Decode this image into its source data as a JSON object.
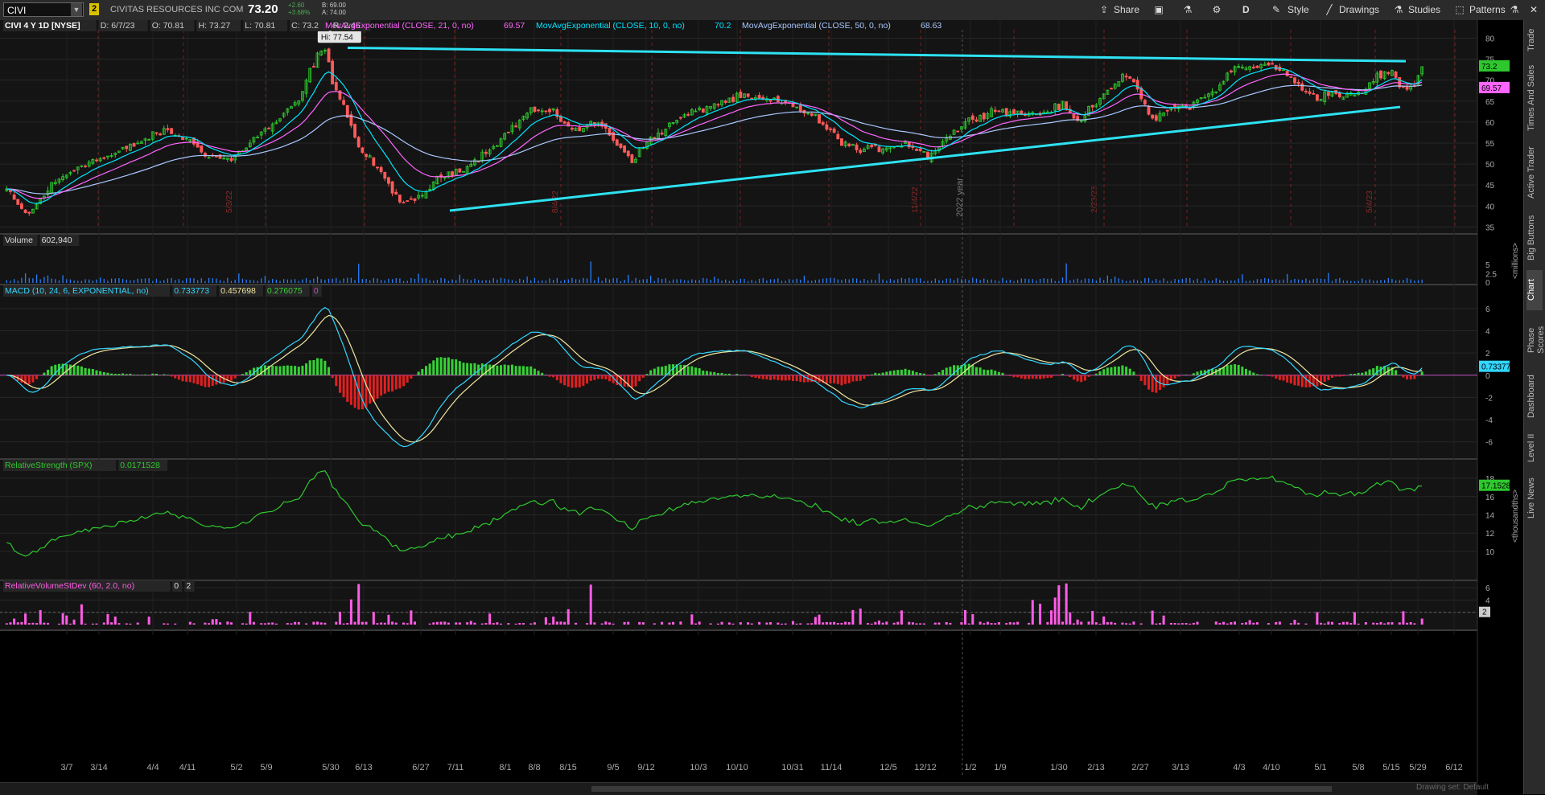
{
  "toolbar": {
    "symbol": "CIVI",
    "link_badge": "2",
    "company": "CIVITAS RESOURCES INC COM",
    "last": "73.20",
    "change": "+2.60",
    "change_pct": "+3.68%",
    "bid": "B: 69.00",
    "ask": "A: 74.00",
    "share_label": "Share",
    "period_label": "D",
    "style_label": "Style",
    "drawings_label": "Drawings",
    "studies_label": "Studies",
    "patterns_label": "Patterns"
  },
  "sidebar": [
    "Trade",
    "Times And Sales",
    "Active Trader",
    "Big Buttons",
    "Chart",
    "Phase Scores",
    "Dashboard",
    "Level II",
    "Live News"
  ],
  "sidebar_active": "Chart",
  "panels": {
    "price": {
      "title": "CIVI 4 Y 1D [NYSE]",
      "ohlc": [
        "D: 6/7/23",
        "O: 70.81",
        "H: 73.27",
        "L: 70.81",
        "C: 73.2",
        "R: 2.46"
      ],
      "studies": [
        {
          "label": "MovAvgExponential (CLOSE, 21, 0, no)",
          "value": "69.57",
          "color": "#ff66ff"
        },
        {
          "label": "MovAvgExponential (CLOSE, 10, 0, no)",
          "value": "70.2",
          "color": "#00e5ff"
        },
        {
          "label": "MovAvgExponential (CLOSE, 50, 0, no)",
          "value": "68.63",
          "color": "#a9c8ff"
        }
      ],
      "hi_label": "Hi: 77.54",
      "year_marker": "2022 year",
      "last_price_tag": "73.2",
      "ema21_tag": "69.57"
    },
    "volume": {
      "title": "Volume",
      "value": "602,940",
      "unit": "<millions>"
    },
    "macd": {
      "title": "MACD (10, 24, 6, EXPONENTIAL, no)",
      "values": [
        "0.733773",
        "0.457698",
        "0.276075",
        "0"
      ],
      "tag": "0.73377"
    },
    "rs": {
      "title": "RelativeStrength (SPX)",
      "value": "0.0171528",
      "tag": "17.1528",
      "unit": "<thousandths>"
    },
    "rvs": {
      "title": "RelativeVolumeStDev (60, 2.0, no)",
      "values": [
        "0",
        "2"
      ],
      "tag": "2"
    }
  },
  "statusbar": "Drawing set: Default",
  "chart_data": {
    "type": "candlestick",
    "x_labels": [
      "3/7",
      "3/14",
      "4/4",
      "4/11",
      "5/2",
      "5/9",
      "5/30",
      "6/13",
      "6/27",
      "7/11",
      "8/1",
      "8/8",
      "8/15",
      "9/5",
      "9/12",
      "10/3",
      "10/10",
      "10/31",
      "11/14",
      "12/5",
      "12/12",
      "1/2",
      "1/9",
      "1/30",
      "2/13",
      "2/27",
      "3/13",
      "4/3",
      "4/10",
      "5/1",
      "5/8",
      "5/15",
      "5/29",
      "6/12"
    ],
    "earnings_markers": [
      "5/3/22",
      "8/4/22",
      "11/4/22",
      "2/23/23",
      "5/4/23"
    ],
    "price_axis": {
      "ticks": [
        35,
        40,
        45,
        50,
        55,
        60,
        65,
        70,
        75,
        80
      ],
      "range": [
        34.5,
        82
      ]
    },
    "price_keypoints": [
      {
        "i": 0,
        "c": 44
      },
      {
        "i": 3,
        "c": 40
      },
      {
        "i": 6,
        "c": 38
      },
      {
        "i": 12,
        "c": 45
      },
      {
        "i": 20,
        "c": 50
      },
      {
        "i": 28,
        "c": 52
      },
      {
        "i": 35,
        "c": 55
      },
      {
        "i": 42,
        "c": 58
      },
      {
        "i": 48,
        "c": 56
      },
      {
        "i": 54,
        "c": 52
      },
      {
        "i": 60,
        "c": 51
      },
      {
        "i": 66,
        "c": 56
      },
      {
        "i": 72,
        "c": 60
      },
      {
        "i": 78,
        "c": 65
      },
      {
        "i": 81,
        "c": 72
      },
      {
        "i": 83,
        "c": 76
      },
      {
        "i": 85,
        "c": 77
      },
      {
        "i": 87,
        "c": 70
      },
      {
        "i": 90,
        "c": 64
      },
      {
        "i": 94,
        "c": 54
      },
      {
        "i": 98,
        "c": 50
      },
      {
        "i": 103,
        "c": 44
      },
      {
        "i": 106,
        "c": 40
      },
      {
        "i": 110,
        "c": 42
      },
      {
        "i": 116,
        "c": 47
      },
      {
        "i": 124,
        "c": 50
      },
      {
        "i": 132,
        "c": 56
      },
      {
        "i": 140,
        "c": 63
      },
      {
        "i": 146,
        "c": 62
      },
      {
        "i": 152,
        "c": 58
      },
      {
        "i": 158,
        "c": 60
      },
      {
        "i": 163,
        "c": 55
      },
      {
        "i": 167,
        "c": 51
      },
      {
        "i": 172,
        "c": 56
      },
      {
        "i": 180,
        "c": 61
      },
      {
        "i": 188,
        "c": 64
      },
      {
        "i": 196,
        "c": 66
      },
      {
        "i": 204,
        "c": 65
      },
      {
        "i": 210,
        "c": 64
      },
      {
        "i": 216,
        "c": 61
      },
      {
        "i": 222,
        "c": 56
      },
      {
        "i": 228,
        "c": 53
      },
      {
        "i": 234,
        "c": 54
      },
      {
        "i": 240,
        "c": 55
      },
      {
        "i": 246,
        "c": 52
      },
      {
        "i": 252,
        "c": 57
      },
      {
        "i": 258,
        "c": 61
      },
      {
        "i": 264,
        "c": 63
      },
      {
        "i": 270,
        "c": 62
      },
      {
        "i": 276,
        "c": 62
      },
      {
        "i": 282,
        "c": 64
      },
      {
        "i": 286,
        "c": 60
      },
      {
        "i": 292,
        "c": 66
      },
      {
        "i": 298,
        "c": 71
      },
      {
        "i": 302,
        "c": 68
      },
      {
        "i": 306,
        "c": 60
      },
      {
        "i": 310,
        "c": 63
      },
      {
        "i": 316,
        "c": 64
      },
      {
        "i": 322,
        "c": 67
      },
      {
        "i": 328,
        "c": 73
      },
      {
        "i": 334,
        "c": 73
      },
      {
        "i": 338,
        "c": 74
      },
      {
        "i": 342,
        "c": 71
      },
      {
        "i": 346,
        "c": 68
      },
      {
        "i": 350,
        "c": 66
      },
      {
        "i": 354,
        "c": 67
      },
      {
        "i": 358,
        "c": 66
      },
      {
        "i": 362,
        "c": 67
      },
      {
        "i": 366,
        "c": 71
      },
      {
        "i": 370,
        "c": 72
      },
      {
        "i": 372,
        "c": 69
      },
      {
        "i": 374,
        "c": 67
      },
      {
        "i": 376,
        "c": 69
      },
      {
        "i": 378,
        "c": 73.2
      }
    ],
    "trendlines": [
      {
        "name": "upper resistance",
        "points": [
          [
            "5/31/22",
            77.7
          ],
          [
            "6/1/23",
            74.5
          ]
        ]
      },
      {
        "name": "lower support",
        "points": [
          [
            "7/14/22",
            38.9
          ],
          [
            "6/1/23",
            63.6
          ]
        ]
      }
    ],
    "volume_axis": {
      "ticks": [
        2.5,
        5
      ],
      "range": [
        0,
        8.5
      ]
    },
    "macd_axis": {
      "ticks": [
        -6,
        -4,
        -2,
        0,
        2,
        4,
        6
      ],
      "range": [
        -6.6,
        7
      ]
    },
    "rs_axis": {
      "ticks": [
        10,
        12,
        14,
        16,
        18
      ],
      "range": [
        8.5,
        19.5
      ]
    },
    "rvs_axis": {
      "ticks": [
        2,
        4,
        6
      ],
      "range": [
        0,
        7.2
      ]
    }
  }
}
